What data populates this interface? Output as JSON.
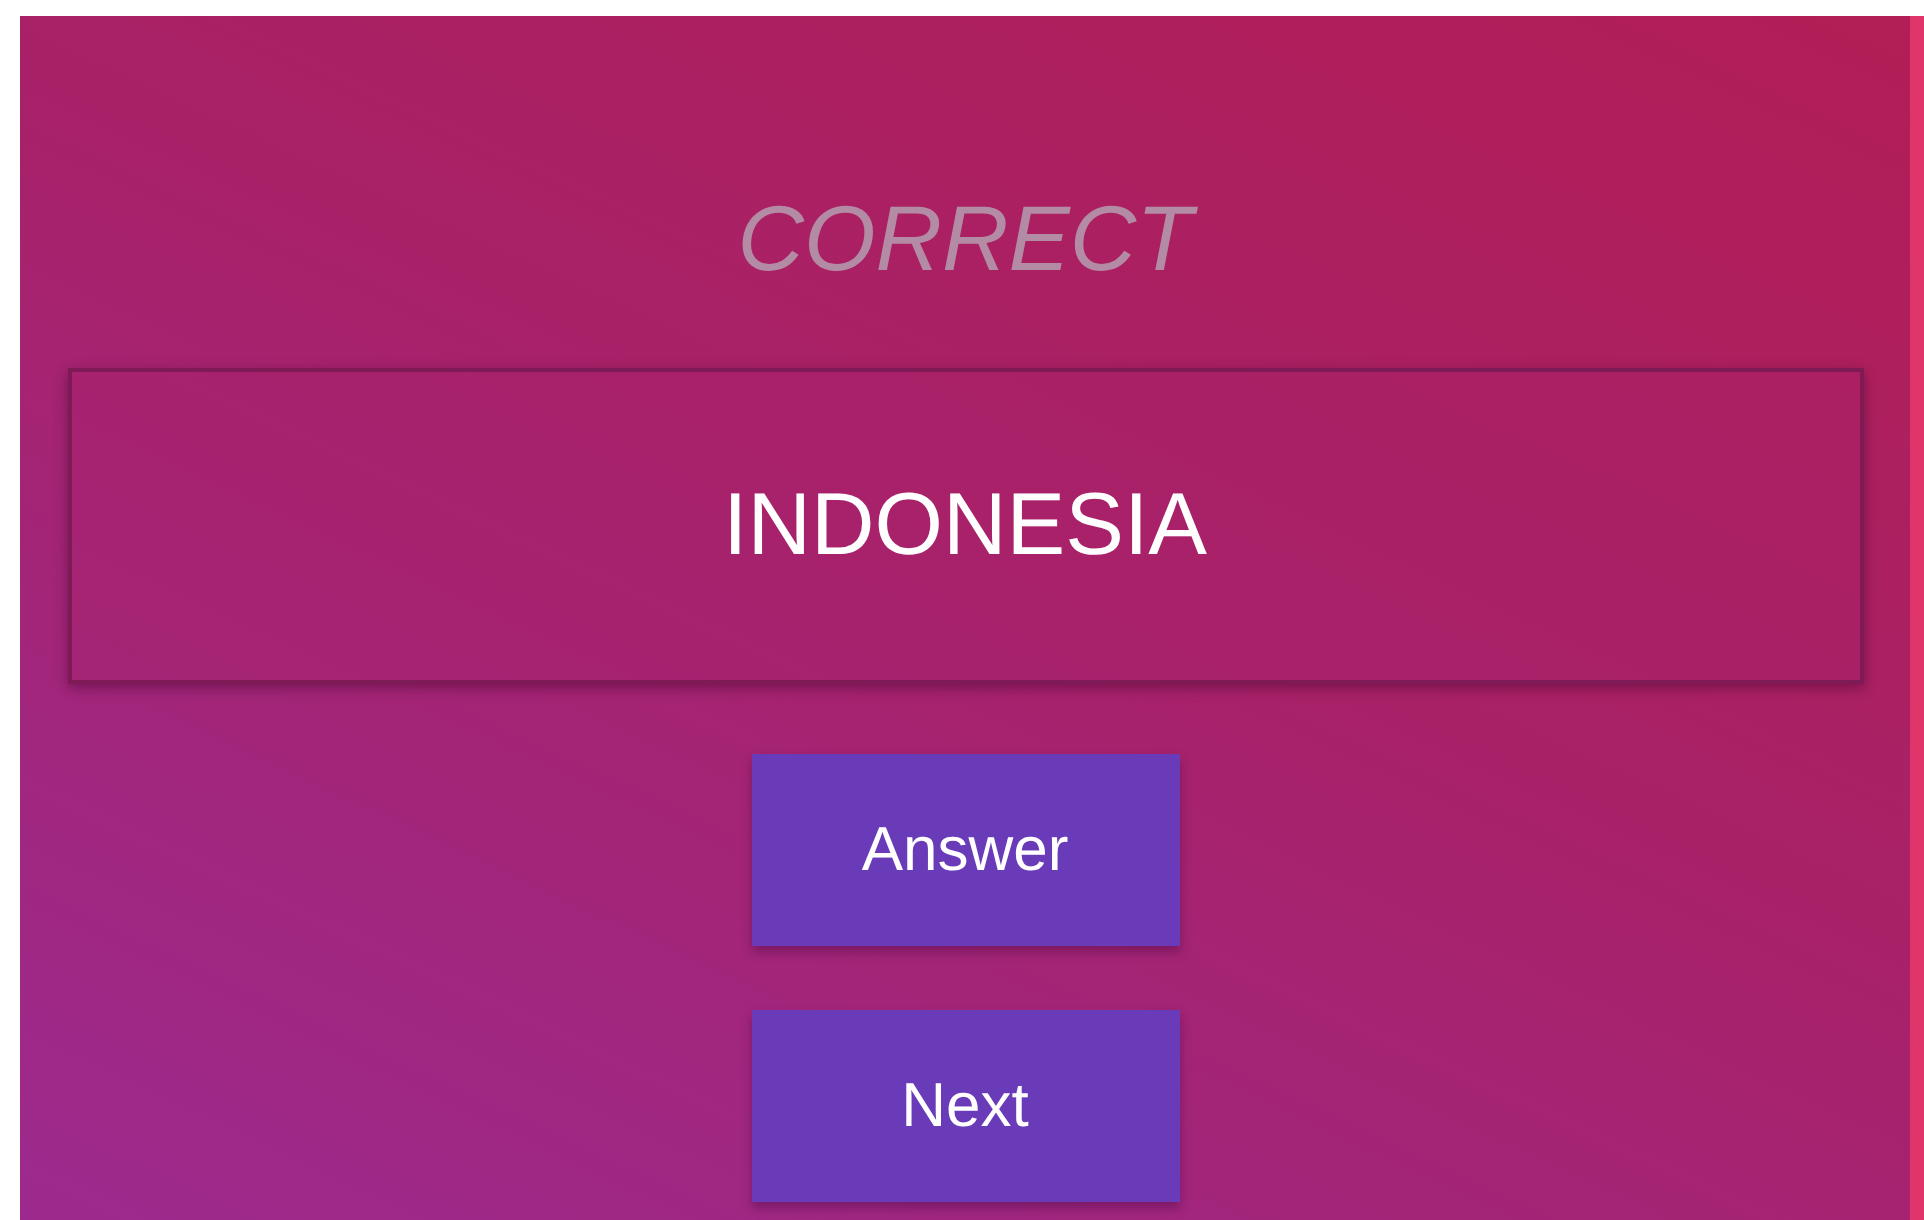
{
  "result": "CORRECT",
  "answer_box": {
    "value": "INDONESIA"
  },
  "buttons": [
    "Answer",
    "Next"
  ]
}
